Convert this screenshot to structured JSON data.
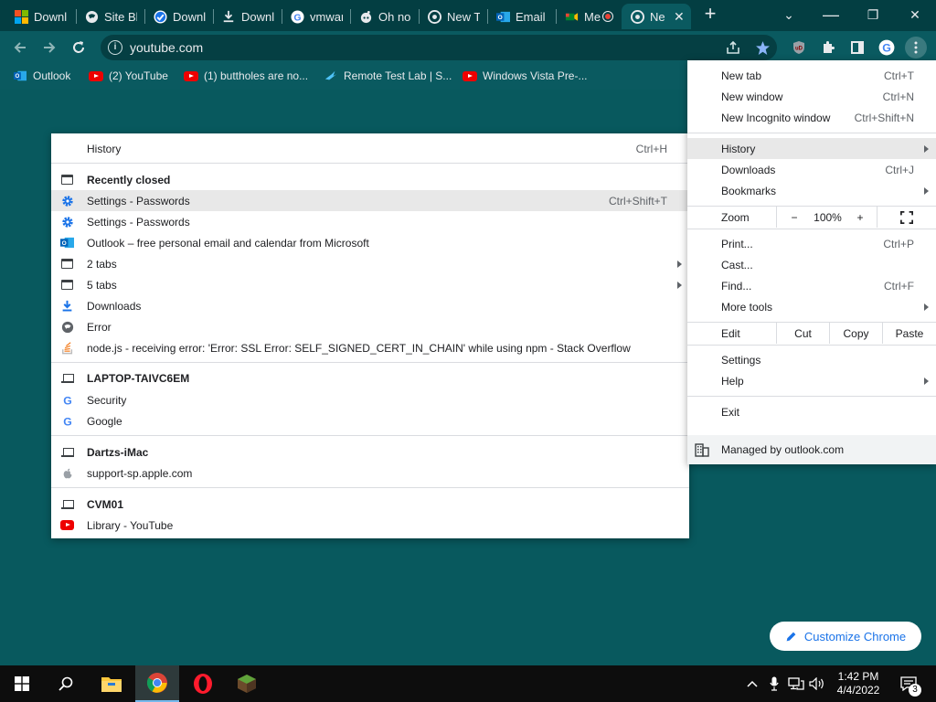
{
  "tabs": [
    {
      "title": "Downl",
      "icon": "microsoft-icon"
    },
    {
      "title": "Site Bl",
      "icon": "globe-icon"
    },
    {
      "title": "Downl",
      "icon": "check-shield-icon"
    },
    {
      "title": "Downl",
      "icon": "download-icon"
    },
    {
      "title": "vmwar",
      "icon": "google-icon"
    },
    {
      "title": "Oh no",
      "icon": "reddit-icon"
    },
    {
      "title": "New T",
      "icon": "chrome-icon"
    },
    {
      "title": "Email",
      "icon": "outlook-icon"
    },
    {
      "title": "Me",
      "icon": "meet-icon"
    },
    {
      "title": "Ne",
      "icon": "chrome-icon",
      "active": true
    }
  ],
  "new_tab_glyph": "+",
  "window_controls": {
    "minimize": "⌄",
    "restore": "❐",
    "close": "✕"
  },
  "omnibox": {
    "url": "youtube.com"
  },
  "bookmarks": [
    {
      "label": "Outlook",
      "icon": "outlook-icon"
    },
    {
      "label": "(2) YouTube",
      "icon": "youtube-icon"
    },
    {
      "label": "(1) buttholes are no...",
      "icon": "youtube-icon"
    },
    {
      "label": "Remote Test Lab | S...",
      "icon": "remote-test-lab-icon"
    },
    {
      "label": "Windows Vista Pre-...",
      "icon": "youtube-icon"
    }
  ],
  "history_menu": {
    "header": {
      "label": "History",
      "shortcut": "Ctrl+H"
    },
    "recently_closed_label": "Recently closed",
    "items": [
      {
        "label": "Settings - Passwords",
        "shortcut": "Ctrl+Shift+T",
        "icon": "gear-icon",
        "highlighted": true
      },
      {
        "label": "Settings - Passwords",
        "shortcut": "",
        "icon": "gear-icon"
      },
      {
        "label": "Outlook – free personal email and calendar from Microsoft",
        "shortcut": "",
        "icon": "outlook-icon"
      },
      {
        "label": "2 tabs",
        "shortcut": "",
        "icon": "window-icon",
        "submenu": true
      },
      {
        "label": "5 tabs",
        "shortcut": "",
        "icon": "window-icon",
        "submenu": true
      },
      {
        "label": "Downloads",
        "shortcut": "",
        "icon": "download-icon"
      },
      {
        "label": "Error",
        "shortcut": "",
        "icon": "globe-icon"
      },
      {
        "label": "node.js - receiving error: 'Error: SSL Error: SELF_SIGNED_CERT_IN_CHAIN' while using npm - Stack Overflow",
        "shortcut": "",
        "icon": "stackoverflow-icon"
      }
    ],
    "devices": [
      {
        "name": "LAPTOP-TAIVC6EM",
        "entries": [
          {
            "label": "Security",
            "icon": "google-icon"
          },
          {
            "label": "Google",
            "icon": "google-icon"
          }
        ]
      },
      {
        "name": "Dartzs-iMac",
        "entries": [
          {
            "label": "support-sp.apple.com",
            "icon": "apple-icon"
          }
        ]
      },
      {
        "name": "CVM01",
        "entries": [
          {
            "label": "Library - YouTube",
            "icon": "youtube-icon"
          }
        ]
      }
    ]
  },
  "main_menu": {
    "new_tab": {
      "label": "New tab",
      "shortcut": "Ctrl+T"
    },
    "new_window": {
      "label": "New window",
      "shortcut": "Ctrl+N"
    },
    "new_incognito": {
      "label": "New Incognito window",
      "shortcut": "Ctrl+Shift+N"
    },
    "history": {
      "label": "History"
    },
    "downloads": {
      "label": "Downloads",
      "shortcut": "Ctrl+J"
    },
    "bookmarks": {
      "label": "Bookmarks"
    },
    "zoom": {
      "label": "Zoom",
      "minus": "−",
      "level": "100%",
      "plus": "+"
    },
    "print": {
      "label": "Print...",
      "shortcut": "Ctrl+P"
    },
    "cast": {
      "label": "Cast..."
    },
    "find": {
      "label": "Find...",
      "shortcut": "Ctrl+F"
    },
    "more_tools": {
      "label": "More tools"
    },
    "edit": {
      "label": "Edit",
      "cut": "Cut",
      "copy": "Copy",
      "paste": "Paste"
    },
    "settings": {
      "label": "Settings"
    },
    "help": {
      "label": "Help"
    },
    "exit": {
      "label": "Exit"
    },
    "managed": {
      "label": "Managed by outlook.com"
    }
  },
  "customize_chrome": {
    "label": "Customize Chrome"
  },
  "taskbar": {
    "time": "1:42 PM",
    "date": "4/4/2022",
    "notification_count": "3"
  },
  "colors": {
    "page_bg": "#08595e",
    "tabstrip_bg": "#033e42",
    "toolbar_bg": "#0a5a60",
    "accent_blue": "#1a73e8",
    "taskbar_bg": "#0d0d0d"
  }
}
